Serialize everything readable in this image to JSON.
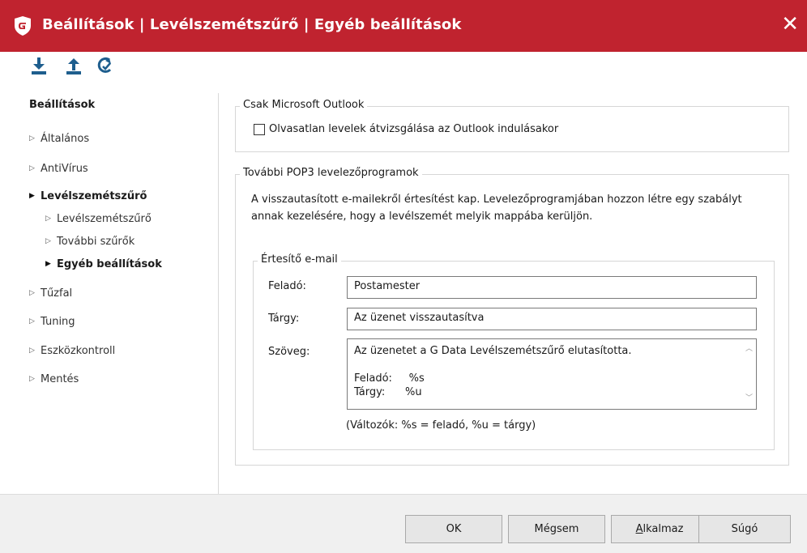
{
  "window": {
    "title": "Beállítások | Levélszemétszűrő | Egyéb beállítások",
    "brand_color": "#c0232f"
  },
  "toolbar": {
    "icons": [
      "import-icon",
      "export-icon",
      "reset-icon"
    ]
  },
  "sidebar": {
    "heading": "Beállítások",
    "items": [
      {
        "label": "Általános"
      },
      {
        "label": "AntiVírus"
      },
      {
        "label": "Levélszemétszűrő"
      },
      {
        "label": "Levélszemétszűrő"
      },
      {
        "label": "További szűrők"
      },
      {
        "label": "Egyéb beállítások"
      },
      {
        "label": "Tűzfal"
      },
      {
        "label": "Tuning"
      },
      {
        "label": "Eszközkontroll"
      },
      {
        "label": "Mentés"
      }
    ]
  },
  "outlook_group": {
    "legend": "Csak Microsoft Outlook",
    "checkbox_label": "Olvasatlan levelek átvizsgálása az Outlook indulásakor",
    "checked": false
  },
  "pop3_group": {
    "legend": "További POP3 levelezőprogramok",
    "description": "A visszautasított e-mailekről értesítést kap. Levelezőprogramjában hozzon létre egy szabályt annak kezelésére, hogy a levélszemét melyik mappába kerüljön."
  },
  "notify_group": {
    "legend": "Értesítő e-mail",
    "sender_label": "Feladó:",
    "sender_value": "Postamester",
    "subject_label": "Tárgy:",
    "subject_value": "Az üzenet visszautasítva",
    "body_label": "Szöveg:",
    "body_lines": [
      "Az üzenetet a G Data Levélszemétszűrő elutasította.",
      "",
      "Feladó:     %s",
      "Tárgy:      %u"
    ],
    "variables_note": "(Változók: %s = feladó, %u = tárgy)"
  },
  "buttons": {
    "ok": "OK",
    "cancel": "Mégsem",
    "apply_first": "A",
    "apply_rest": "lkalmaz",
    "help": "Súgó"
  }
}
